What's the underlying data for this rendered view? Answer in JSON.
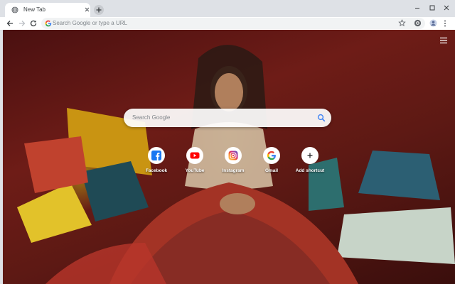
{
  "tab": {
    "title": "New Tab"
  },
  "toolbar": {
    "omnibox_placeholder": "Search Google or type a URL"
  },
  "page": {
    "search_placeholder": "Search Google",
    "shortcuts": [
      {
        "label": "Facebook",
        "icon": "facebook-icon",
        "color": "#1877f2"
      },
      {
        "label": "YouTube",
        "icon": "youtube-icon",
        "color": "#ff0000"
      },
      {
        "label": "Instagram",
        "icon": "instagram-icon",
        "color": "#c13584"
      },
      {
        "label": "Gmail",
        "icon": "google-icon",
        "color": "#4285f4"
      },
      {
        "label": "Add shortcut",
        "icon": "plus-icon",
        "color": "#202124"
      }
    ]
  }
}
